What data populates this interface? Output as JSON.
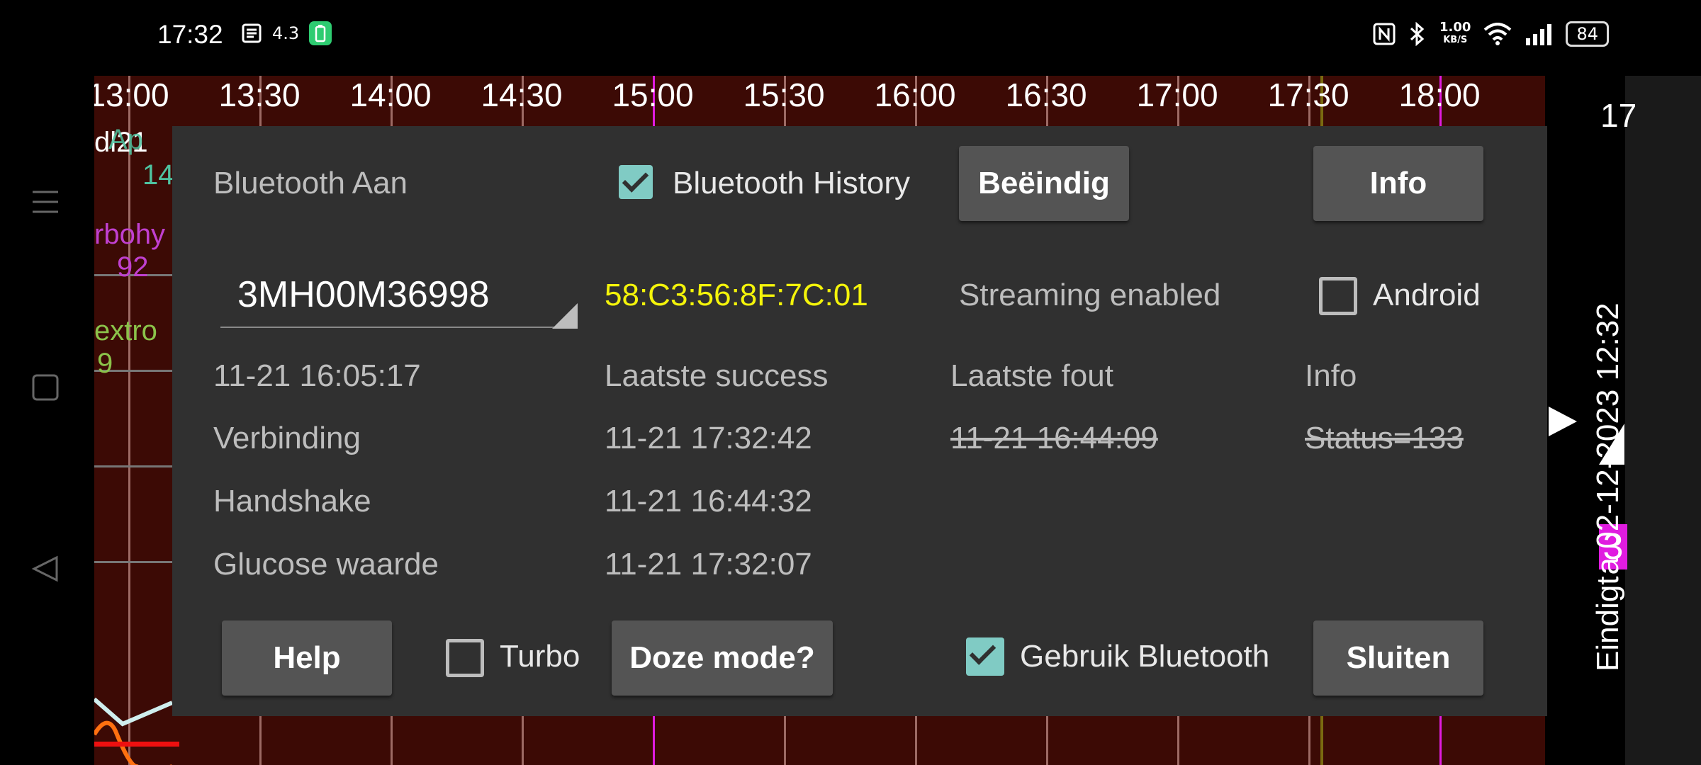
{
  "status_bar": {
    "time": "17:32",
    "left_icons": [
      "notes-icon",
      "4.3",
      "battery-saver-icon"
    ],
    "net_speed_value": "1.00",
    "net_speed_unit": "KB/S",
    "battery": "84"
  },
  "graph": {
    "time_labels": [
      "13:00",
      "13:30",
      "14:00",
      "14:30",
      "15:00",
      "15:30",
      "16:00",
      "16:30",
      "17:00",
      "17:30",
      "18:00"
    ],
    "legend": {
      "line1": "dl21",
      "line1_overlay": "Ap",
      "line1_value": "14",
      "carbohydrates": "rbohy",
      "carbohydrates_value": "92",
      "dextro": "extro",
      "dextro_value": "9"
    },
    "right_label": "17",
    "vertical_text": "Eindigt",
    "vertical_text_2": "a 02-12-2023 12:32",
    "magenta_badge": "3",
    "colors": {
      "background": "#3c0a05",
      "magenta": "#e01ce0",
      "carbs": "#c040d0",
      "dextro": "#8bc34a",
      "teal": "#4fc3a0"
    }
  },
  "dialog": {
    "bluetooth_status": "Bluetooth Aan",
    "bluetooth_history_label": "Bluetooth History",
    "bluetooth_history_checked": true,
    "end_button": "Beëindig",
    "info_button": "Info",
    "sensor_select_value": "3MH00M36998",
    "mac_address": "58:C3:56:8F:7C:01",
    "streaming_text": "Streaming enabled",
    "android_label": "Android",
    "android_checked": false,
    "header": {
      "timestamp": "11-21 16:05:17",
      "col_success": "Laatste success",
      "col_error": "Laatste fout",
      "col_info": "Info"
    },
    "rows": [
      {
        "label": "Verbinding",
        "success": "11-21 17:32:42",
        "error": "11-21 16:44:09",
        "info": "Status=133"
      },
      {
        "label": "Handshake",
        "success": "11-21 16:44:32",
        "error": "",
        "info": ""
      },
      {
        "label": "Glucose waarde",
        "success": "11-21 17:32:07",
        "error": "",
        "info": ""
      }
    ],
    "help_button": "Help",
    "turbo_label": "Turbo",
    "turbo_checked": false,
    "doze_button": "Doze mode?",
    "use_bluetooth_label": "Gebruik Bluetooth",
    "use_bluetooth_checked": true,
    "close_button": "Sluiten",
    "colors": {
      "mac_address": "#f4f40a",
      "accent_checkbox": "#80cbc4"
    }
  }
}
